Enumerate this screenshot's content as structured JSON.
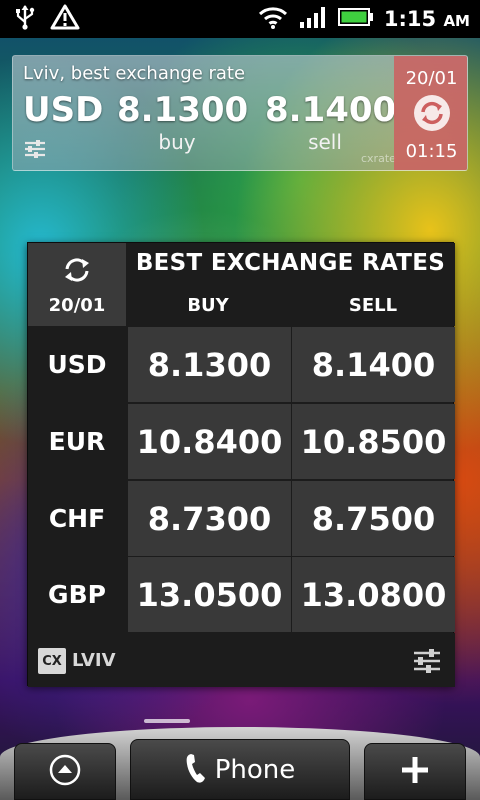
{
  "status_bar": {
    "time": "1:15",
    "ampm": "AM"
  },
  "top_widget": {
    "city_label": "Lviv, best exchange rate",
    "currency": "USD",
    "buy_value": "8.1300",
    "buy_label": "buy",
    "sell_value": "8.1400",
    "sell_label": "sell",
    "brand": "cxrate",
    "date": "20/01",
    "time": "01:15",
    "accent_color": "#cd5f5f"
  },
  "rates_widget": {
    "date": "20/01",
    "title": "BEST EXCHANGE RATES",
    "col_buy": "BUY",
    "col_sell": "SELL",
    "rows": [
      {
        "code": "USD",
        "buy": "8.1300",
        "sell": "8.1400"
      },
      {
        "code": "EUR",
        "buy": "10.8400",
        "sell": "10.8500"
      },
      {
        "code": "CHF",
        "buy": "8.7300",
        "sell": "8.7500"
      },
      {
        "code": "GBP",
        "buy": "13.0500",
        "sell": "13.0800"
      }
    ],
    "logo_text": "CX",
    "city": "LVIV"
  },
  "dock": {
    "phone_label": "Phone"
  }
}
